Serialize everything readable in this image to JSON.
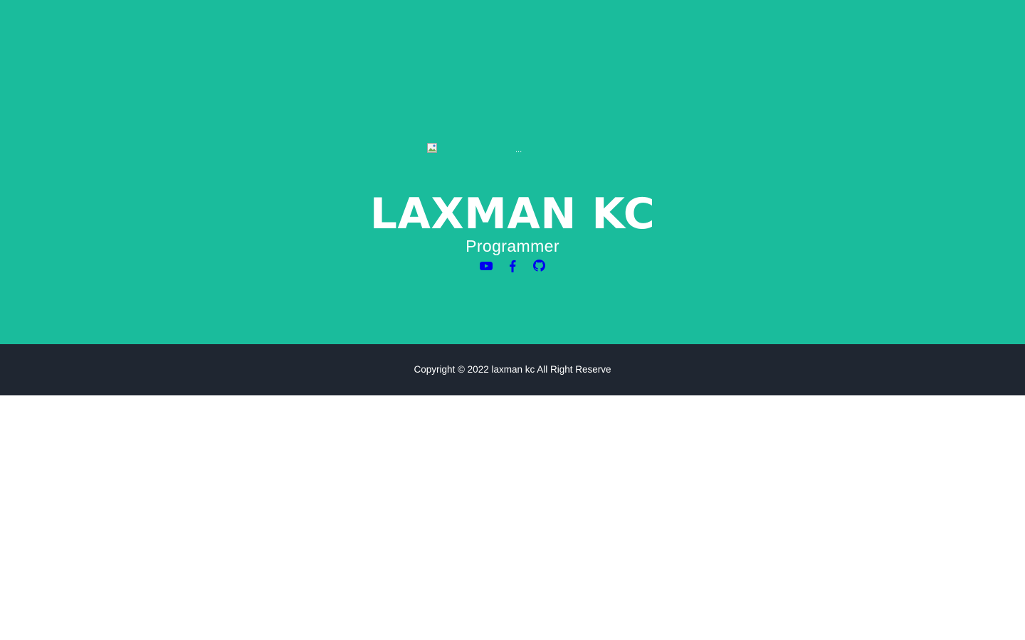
{
  "header": {
    "avatar_alt": "...",
    "name": "LAXMAN KC",
    "role": "Programmer"
  },
  "social": [
    {
      "icon": "youtube-icon",
      "color": "#0000ee"
    },
    {
      "icon": "facebook-icon",
      "color": "#0000ee"
    },
    {
      "icon": "github-icon",
      "color": "#0000ee"
    }
  ],
  "footer": {
    "copyright": "Copyright © 2022 laxman kc All Right Reserve"
  },
  "colors": {
    "masthead_bg": "#1abc9c",
    "footer_bg": "#1f2631",
    "text": "#ffffff",
    "link": "#0000ee"
  }
}
